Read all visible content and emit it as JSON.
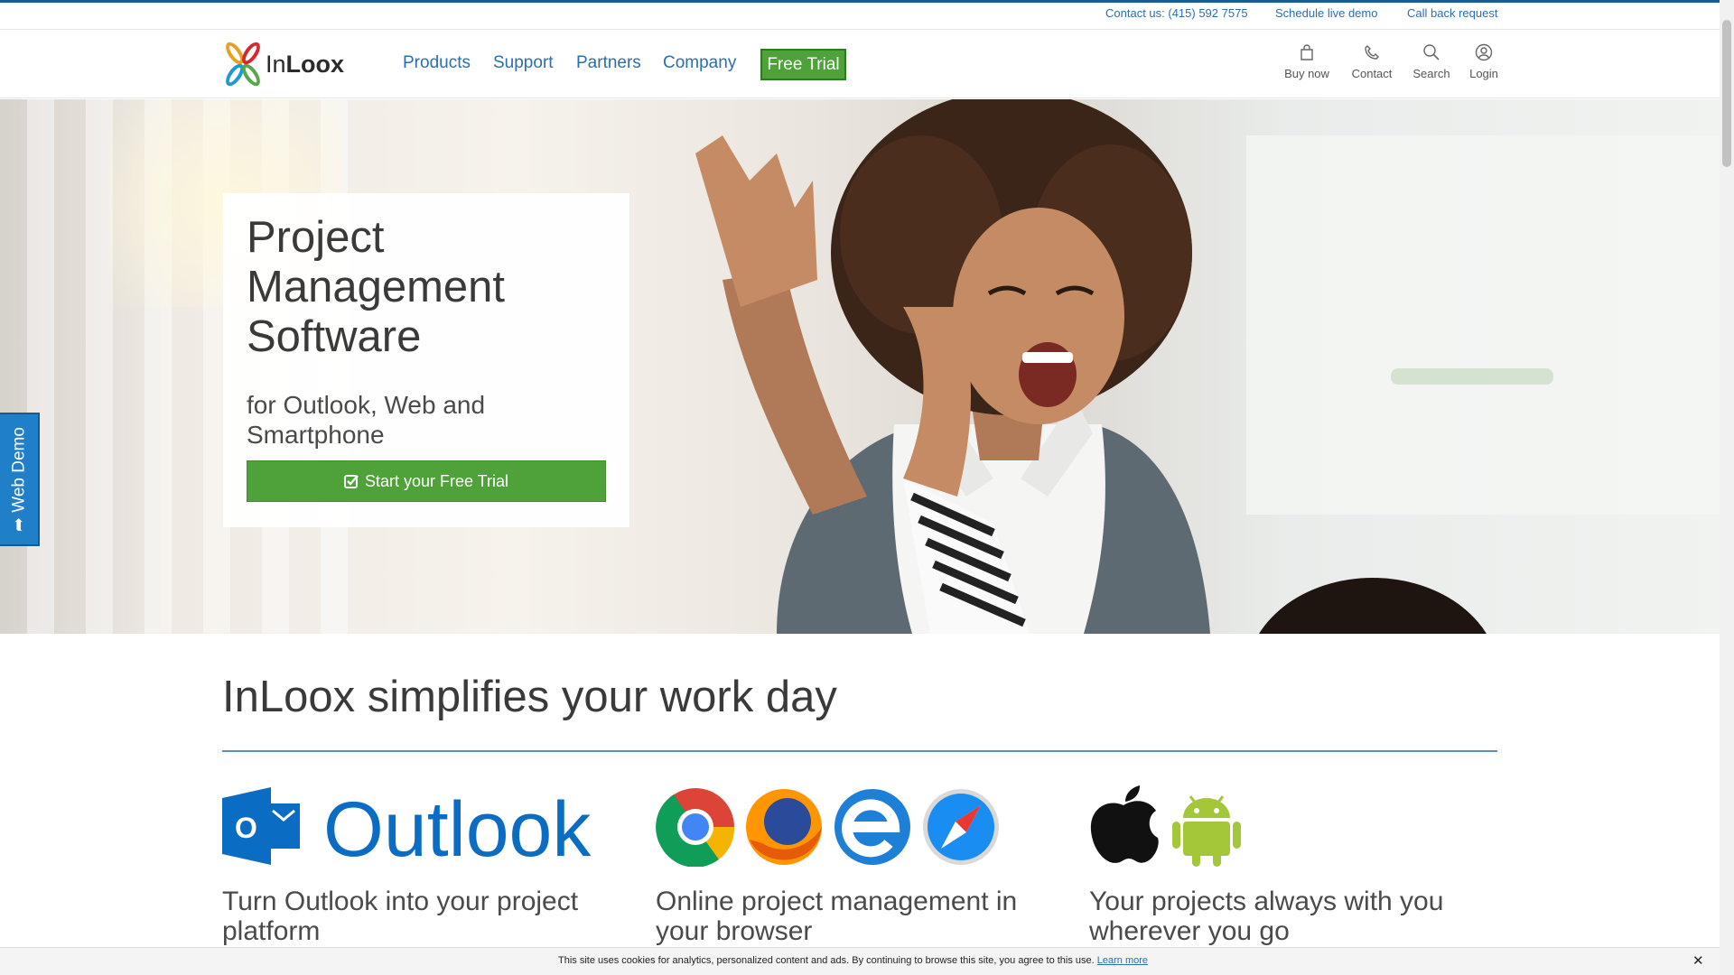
{
  "utility_links": {
    "contact": "Contact us: (415) 592 7575",
    "demo": "Schedule live demo",
    "callback": "Call back request"
  },
  "brand": {
    "name_light": "In",
    "name_bold": "Loox"
  },
  "nav": {
    "products": "Products",
    "support": "Support",
    "partners": "Partners",
    "company": "Company",
    "free_trial": "Free Trial"
  },
  "header_icons": {
    "buy": "Buy now",
    "contact": "Contact",
    "search": "Search",
    "login": "Login"
  },
  "hero": {
    "title": "Project Management Software",
    "subtitle": "for Outlook, Web and Smartphone",
    "cta": "Start your Free Trial"
  },
  "web_demo": "Web Demo",
  "section": {
    "title": "InLoox simplifies your work day",
    "outlook_word": "Outlook",
    "outlook_letter": "O",
    "features": [
      {
        "text": "Turn Outlook into your project platform"
      },
      {
        "text": "Online project management in your browser"
      },
      {
        "text": "Your projects always with you wherever you go"
      }
    ]
  },
  "cookie": {
    "text": "This site uses cookies for analytics, personalized content and ads. By continuing to browse this site, you agree to this use.",
    "link": "Learn more",
    "close": "✕"
  },
  "colors": {
    "link": "#2a6fb0",
    "green": "#4fa23a",
    "outlook_blue": "#0a6cc2"
  }
}
